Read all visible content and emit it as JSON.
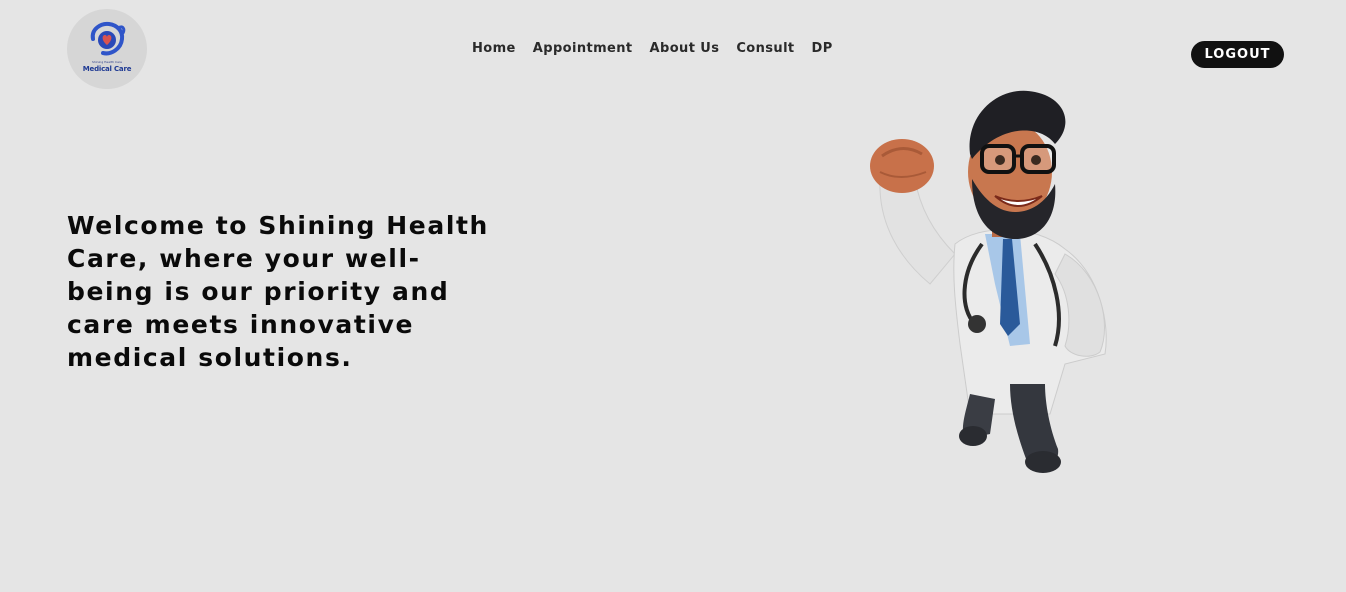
{
  "header": {
    "logo": {
      "tagline": "Shining Health Care",
      "brand": "Medical Care",
      "icon": "heart-hands-icon"
    },
    "nav": {
      "items": [
        {
          "label": "Home"
        },
        {
          "label": "Appointment"
        },
        {
          "label": "About Us"
        },
        {
          "label": "Consult"
        },
        {
          "label": "DP"
        }
      ]
    },
    "logout_label": "LOGOUT"
  },
  "hero": {
    "headline": "Welcome to Shining Health Care, where your well-being is our priority and care meets innovative medical solutions."
  },
  "illustration": {
    "subject": "doctor-superhero-illustration"
  },
  "colors": {
    "background": "#e5e5e5",
    "logout_bg": "#111111",
    "logo_blue": "#1f3a93",
    "heart_red": "#d9534f"
  }
}
